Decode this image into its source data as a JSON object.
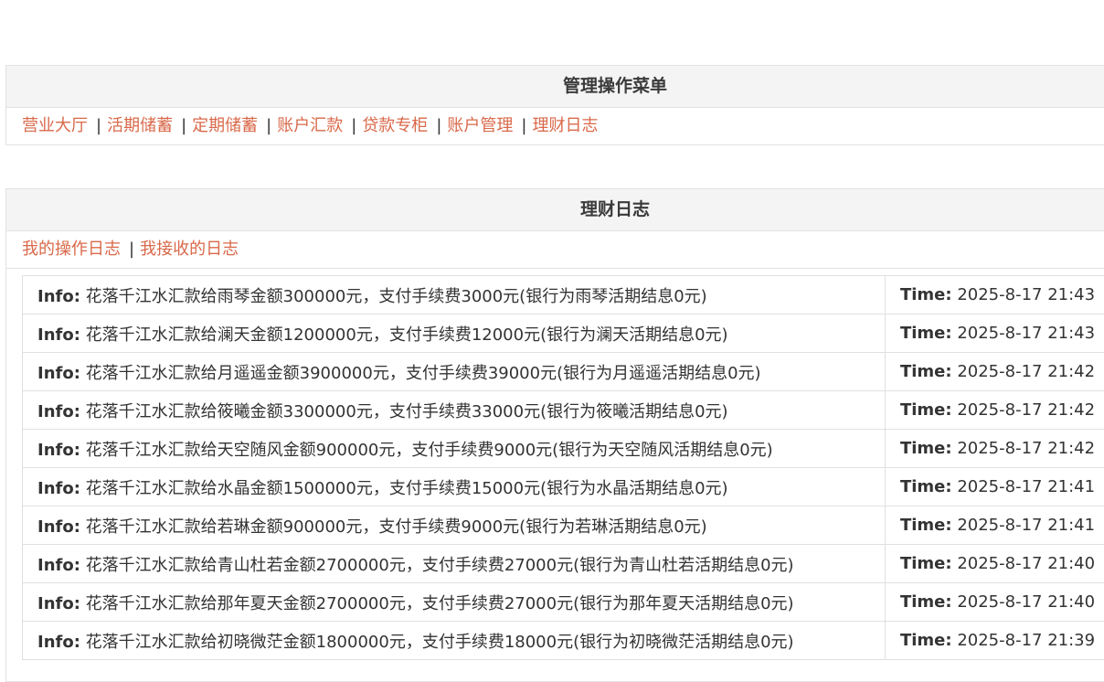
{
  "menu": {
    "title": "管理操作菜单",
    "items": [
      {
        "label": "营业大厅"
      },
      {
        "label": "活期储蓄"
      },
      {
        "label": "定期储蓄"
      },
      {
        "label": "账户汇款"
      },
      {
        "label": "贷款专柜"
      },
      {
        "label": "账户管理"
      },
      {
        "label": "理财日志"
      }
    ],
    "separator": "|"
  },
  "log": {
    "title": "理财日志",
    "tabs": [
      {
        "label": "我的操作日志"
      },
      {
        "label": "我接收的日志"
      }
    ],
    "info_label": "Info:",
    "time_label": "Time:",
    "rows": [
      {
        "info": "花落千江水汇款给雨琴金额300000元，支付手续费3000元(银行为雨琴活期结息0元)",
        "time": "2025-8-17 21:43"
      },
      {
        "info": "花落千江水汇款给澜天金额1200000元，支付手续费12000元(银行为澜天活期结息0元)",
        "time": "2025-8-17 21:43"
      },
      {
        "info": "花落千江水汇款给月遥遥金额3900000元，支付手续费39000元(银行为月遥遥活期结息0元)",
        "time": "2025-8-17 21:42"
      },
      {
        "info": "花落千江水汇款给筱曦金额3300000元，支付手续费33000元(银行为筱曦活期结息0元)",
        "time": "2025-8-17 21:42"
      },
      {
        "info": "花落千江水汇款给天空随风金额900000元，支付手续费9000元(银行为天空随风活期结息0元)",
        "time": "2025-8-17 21:42"
      },
      {
        "info": "花落千江水汇款给水晶金额1500000元，支付手续费15000元(银行为水晶活期结息0元)",
        "time": "2025-8-17 21:41"
      },
      {
        "info": "花落千江水汇款给若琳金额900000元，支付手续费9000元(银行为若琳活期结息0元)",
        "time": "2025-8-17 21:41"
      },
      {
        "info": "花落千江水汇款给青山杜若金额2700000元，支付手续费27000元(银行为青山杜若活期结息0元)",
        "time": "2025-8-17 21:40"
      },
      {
        "info": "花落千江水汇款给那年夏天金额2700000元，支付手续费27000元(银行为那年夏天活期结息0元)",
        "time": "2025-8-17 21:40"
      },
      {
        "info": "花落千江水汇款给初晓微茫金额1800000元，支付手续费18000元(银行为初晓微茫活期结息0元)",
        "time": "2025-8-17 21:39"
      }
    ]
  }
}
